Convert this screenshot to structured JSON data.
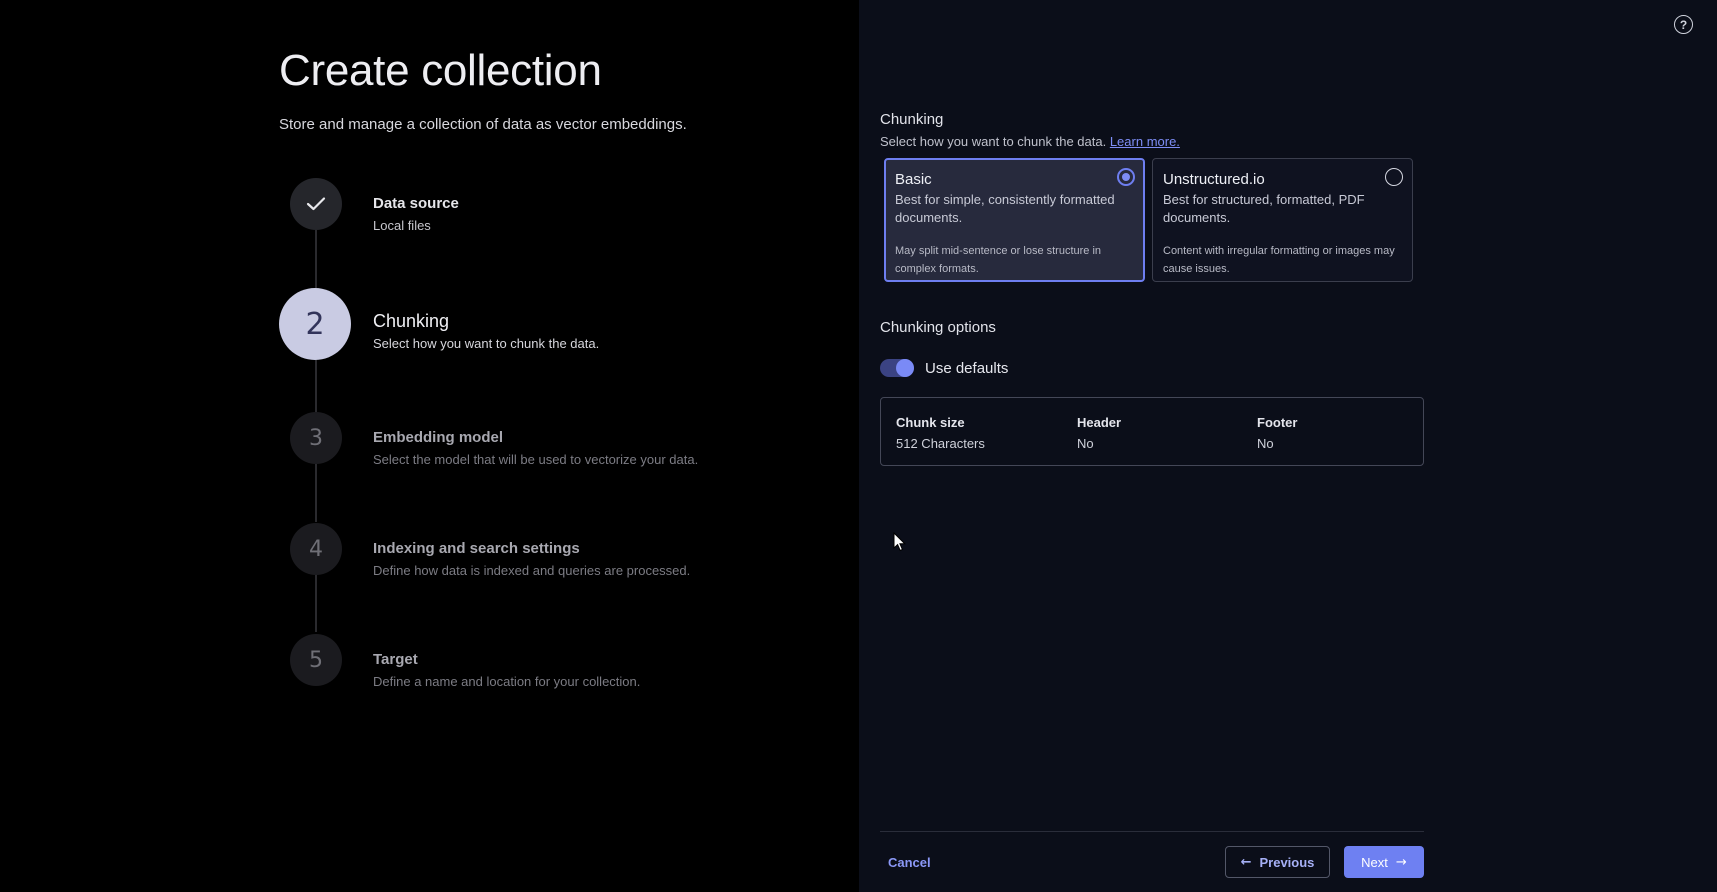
{
  "wizard": {
    "title": "Create collection",
    "subtitle": "Store and manage a collection of data as vector embeddings.",
    "steps": [
      {
        "icon": "check-icon",
        "title": "Data source",
        "desc": "Local files",
        "state": "complete"
      },
      {
        "number": "2",
        "title": "Chunking",
        "desc": "Select how you want to chunk the data.",
        "state": "current"
      },
      {
        "number": "3",
        "title": "Embedding model",
        "desc": "Select the model that will be used to vectorize your data.",
        "state": "upcoming"
      },
      {
        "number": "4",
        "title": "Indexing and search settings",
        "desc": "Define how data is indexed and queries are processed.",
        "state": "upcoming"
      },
      {
        "number": "5",
        "title": "Target",
        "desc": "Define a name and location for your collection.",
        "state": "upcoming"
      }
    ]
  },
  "help": {
    "icon": "help-icon",
    "label": "?"
  },
  "chunking": {
    "title": "Chunking",
    "desc": "Select how you want to chunk the data.",
    "learn_more": "Learn more.",
    "options": [
      {
        "title": "Basic",
        "desc": "Best for simple, consistently formatted documents.",
        "note": "May split mid-sentence or lose structure in complex formats.",
        "selected": true
      },
      {
        "title": "Unstructured.io",
        "desc": "Best for structured, formatted, PDF documents.",
        "note": "Content with irregular formatting or images may cause issues.",
        "selected": false
      }
    ]
  },
  "chunking_options": {
    "title": "Chunking options",
    "use_defaults_label": "Use defaults",
    "use_defaults_on": true,
    "fields": [
      {
        "label": "Chunk size",
        "value": "512 Characters"
      },
      {
        "label": "Header",
        "value": "No"
      },
      {
        "label": "Footer",
        "value": "No"
      }
    ]
  },
  "footer": {
    "cancel": "Cancel",
    "previous": "Previous",
    "next": "Next"
  },
  "colors": {
    "accent": "#6e80f2",
    "right_panel_bg": "#0b0e19",
    "left_panel_bg": "#000000"
  }
}
